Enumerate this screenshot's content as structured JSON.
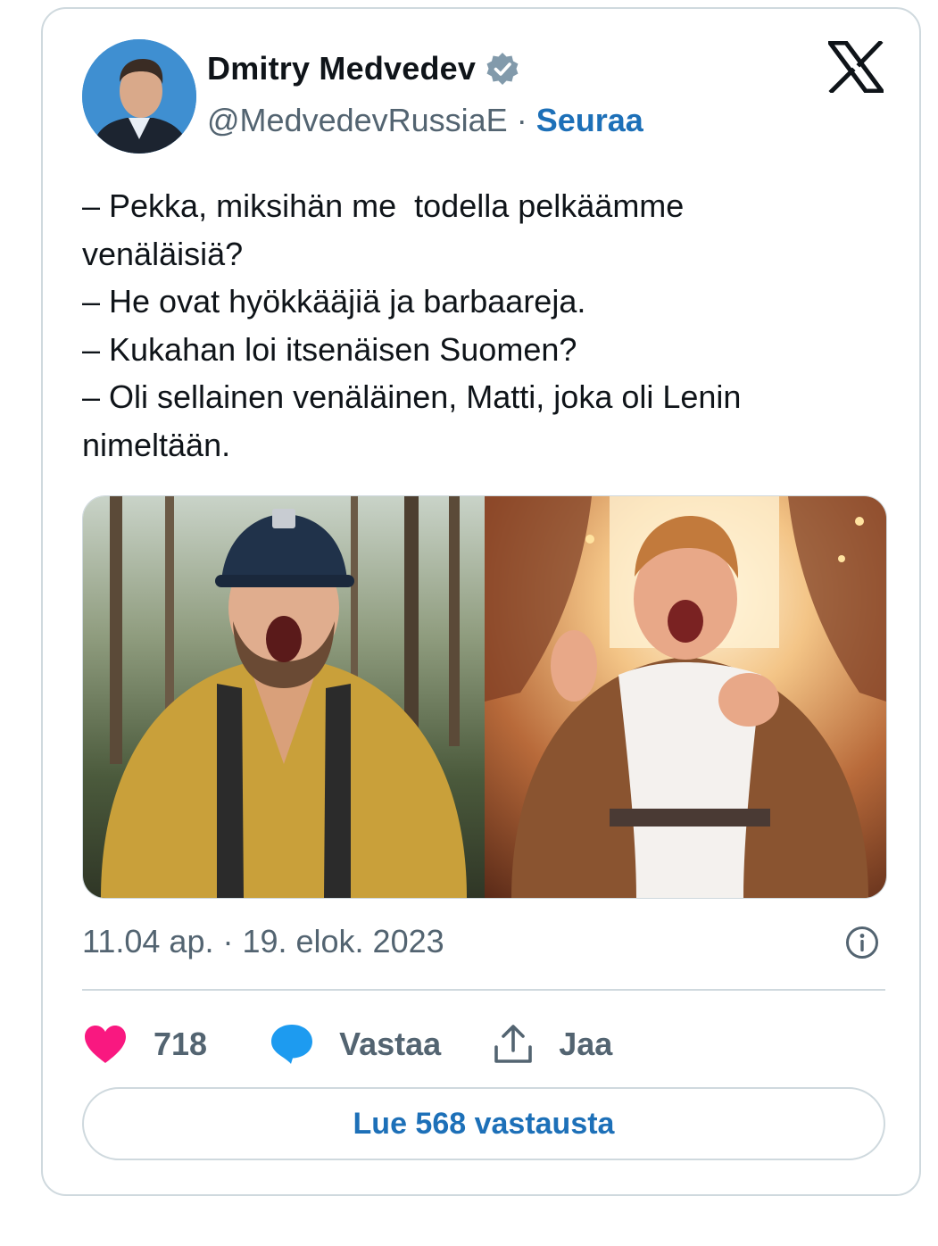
{
  "author": {
    "name": "Dmitry Medvedev",
    "handle": "@MedvedevRussiaE",
    "separator": "·",
    "follow_label": "Seuraa",
    "verified": true
  },
  "tweet": {
    "lines": [
      "– Pekka, miksihän me  todella pelkäämme",
      "venäläisiä?",
      "– He ovat hyökkääjiä ja barbaareja.",
      "– Kukahan loi itsenäisen Suomen?",
      "– Oli sellainen venäläinen, Matti, joka oli Lenin",
      "nimeltään."
    ],
    "timestamp": "11.04 ap. · 19. elok. 2023"
  },
  "actions": {
    "like_count": "718",
    "reply_label": "Vastaa",
    "share_label": "Jaa"
  },
  "read_replies_label": "Lue 568 vastausta",
  "colors": {
    "accent": "#1d70b8",
    "heart": "#f91880",
    "reply_bubble": "#1d9bf0",
    "secondary_text": "#536471",
    "border": "#cfd9de"
  },
  "icons": {
    "platform": "x-logo-icon",
    "verified": "verified-badge-icon",
    "info": "info-icon",
    "like": "heart-icon",
    "reply": "speech-bubble-icon",
    "share": "share-upload-icon"
  }
}
